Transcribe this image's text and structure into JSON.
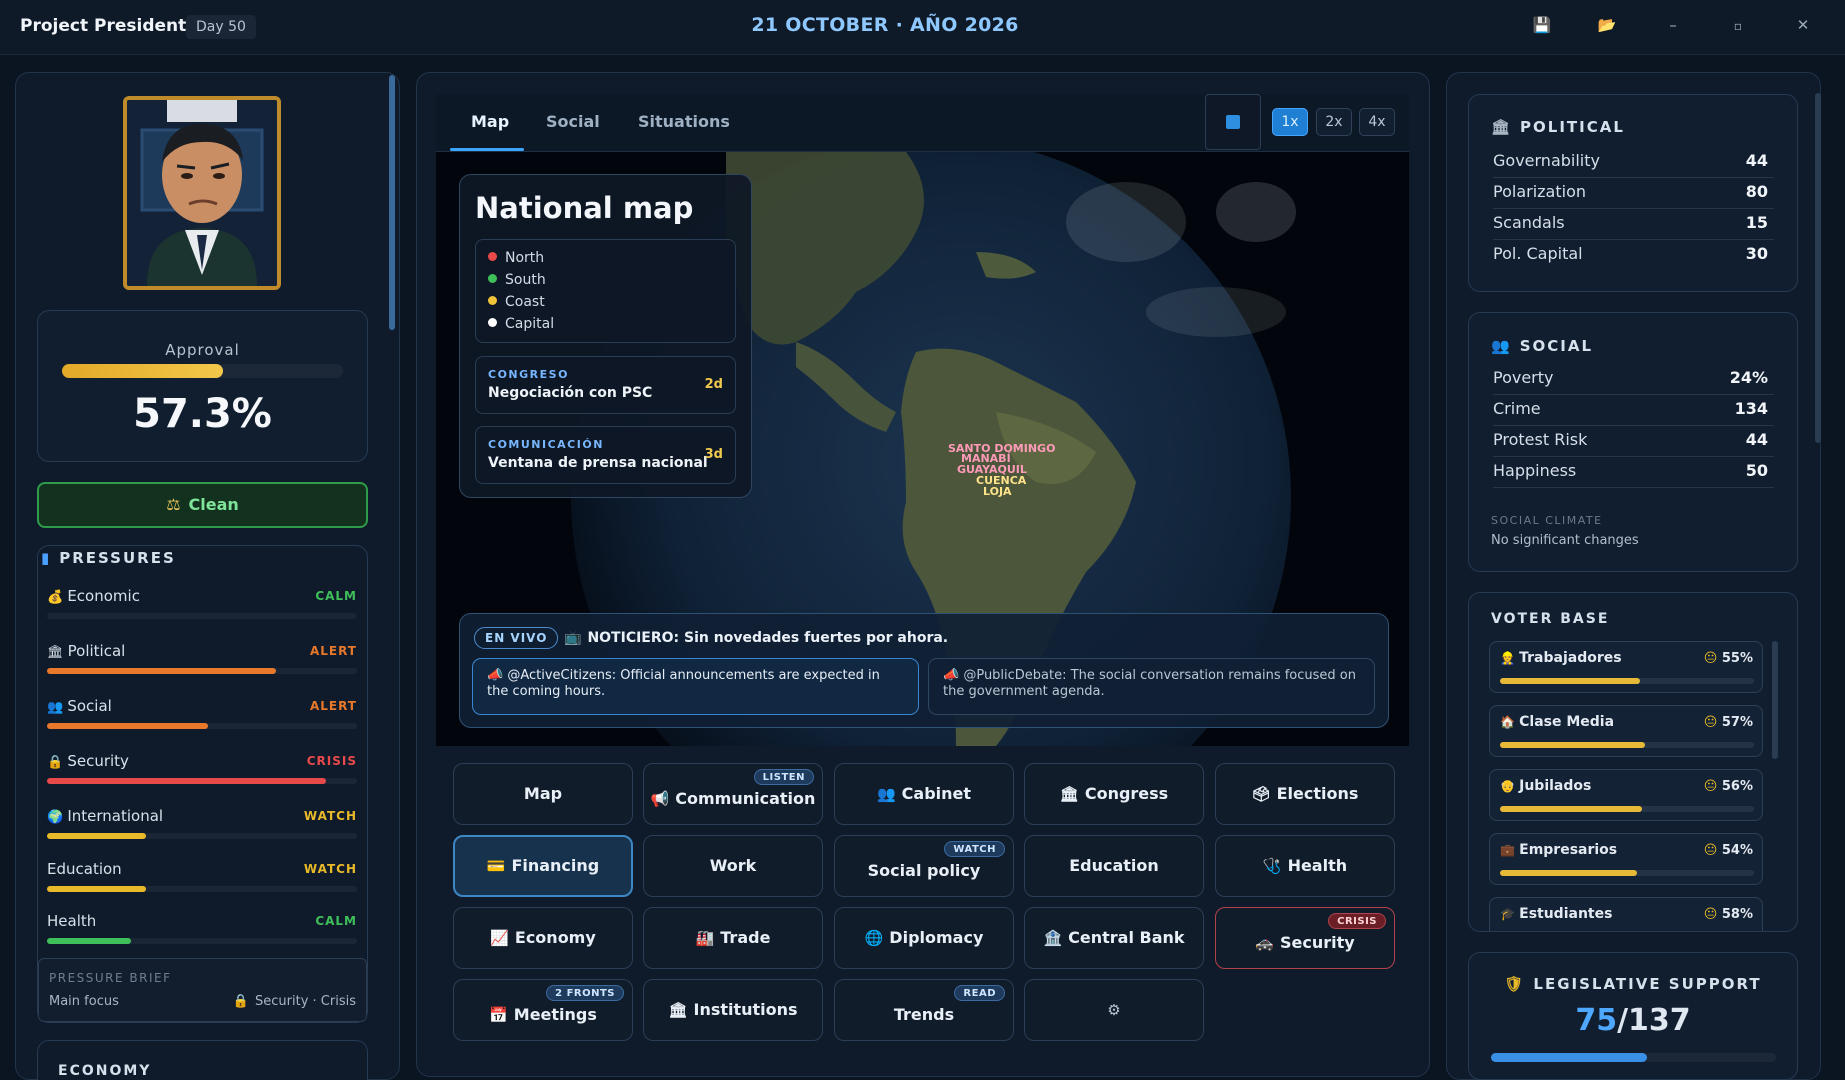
{
  "titlebar": {
    "app_title": "Project President",
    "day": "Day 50",
    "date": "21 OCTOBER · AÑO 2026",
    "icons": [
      "save-icon",
      "folder-icon",
      "minimize-icon",
      "maximize-icon",
      "close-icon"
    ]
  },
  "left": {
    "approval_label": "Approval",
    "approval_value": "57.3%",
    "approval_level": 0.573,
    "integrity_label": "Clean",
    "pressures_title": "PRESSURES",
    "pressures": [
      {
        "label": "Economic",
        "status": "CALM",
        "level": 0.0,
        "color": "#3fbf5a"
      },
      {
        "label": "Political",
        "status": "ALERT",
        "level": 0.74,
        "color": "#e8782a"
      },
      {
        "label": "Social",
        "status": "ALERT",
        "level": 0.52,
        "color": "#e8782a"
      },
      {
        "label": "Security",
        "status": "CRISIS",
        "level": 0.9,
        "color": "#e84a4a"
      },
      {
        "label": "International",
        "status": "WATCH",
        "level": 0.32,
        "color": "#e8b928"
      },
      {
        "label": "Education",
        "status": "WATCH",
        "level": 0.32,
        "color": "#e8b928"
      },
      {
        "label": "Health",
        "status": "CALM",
        "level": 0.27,
        "color": "#3fbf5a"
      }
    ],
    "brief_title": "PRESSURE BRIEF",
    "brief_focus_label": "Main focus",
    "brief_focus_value": "Security · Crisis",
    "economy_title": "ECONOMY"
  },
  "center": {
    "tabs": [
      "Map",
      "Social",
      "Situations"
    ],
    "speeds": [
      "1x",
      "2x",
      "4x"
    ],
    "active_speed": "1x",
    "map_panel": {
      "title": "National map",
      "legend": [
        {
          "label": "North",
          "color": "#e84a4a"
        },
        {
          "label": "South",
          "color": "#3fbf5a"
        },
        {
          "label": "Coast",
          "color": "#f0c23a"
        },
        {
          "label": "Capital",
          "color": "#ffffff"
        }
      ],
      "events": [
        {
          "tag": "CONGRESO",
          "text": "Negociación con PSC",
          "days": "2d"
        },
        {
          "tag": "COMUNICACIÓN",
          "text": "Ventana de prensa nacional",
          "days": "3d"
        }
      ]
    },
    "cities": [
      "SANTO DOMINGO",
      "MANABÍ",
      "GUAYAQUIL",
      "CUENCA",
      "LOJA"
    ],
    "news": {
      "live_label": "EN VIVO",
      "headline": "NOTICIERO: Sin novedades fuertes por ahora.",
      "posts": [
        "@ActiveCitizens: Official announcements are expected in the coming hours.",
        "@PublicDebate: The social conversation remains focused on the government agenda."
      ]
    },
    "actions": [
      {
        "label": "Map",
        "icon": "",
        "badge": ""
      },
      {
        "label": "Communication",
        "icon": "📢",
        "badge": "LISTEN"
      },
      {
        "label": "Cabinet",
        "icon": "👥",
        "badge": ""
      },
      {
        "label": "Congress",
        "icon": "🏛",
        "badge": ""
      },
      {
        "label": "Elections",
        "icon": "🗳",
        "badge": ""
      },
      {
        "label": "Financing",
        "icon": "💳",
        "badge": ""
      },
      {
        "label": "Work",
        "icon": "",
        "badge": ""
      },
      {
        "label": "Social policy",
        "icon": "",
        "badge": "WATCH"
      },
      {
        "label": "Education",
        "icon": "",
        "badge": ""
      },
      {
        "label": "Health",
        "icon": "🩺",
        "badge": ""
      },
      {
        "label": "Economy",
        "icon": "📈",
        "badge": ""
      },
      {
        "label": "Trade",
        "icon": "🏭",
        "badge": ""
      },
      {
        "label": "Diplomacy",
        "icon": "🌐",
        "badge": ""
      },
      {
        "label": "Central Bank",
        "icon": "🏦",
        "badge": ""
      },
      {
        "label": "Security",
        "icon": "🚓",
        "badge": "CRISIS"
      },
      {
        "label": "Meetings",
        "icon": "📅",
        "badge": "2 FRONTS"
      },
      {
        "label": "Institutions",
        "icon": "🏛",
        "badge": ""
      },
      {
        "label": "Trends",
        "icon": "",
        "badge": "READ"
      },
      {
        "label": "",
        "icon": "⚙",
        "badge": ""
      }
    ]
  },
  "right": {
    "political_title": "POLITICAL",
    "political": [
      {
        "label": "Governability",
        "value": "44"
      },
      {
        "label": "Polarization",
        "value": "80"
      },
      {
        "label": "Scandals",
        "value": "15"
      },
      {
        "label": "Pol. Capital",
        "value": "30"
      }
    ],
    "social_title": "SOCIAL",
    "social": [
      {
        "label": "Poverty",
        "value": "24%"
      },
      {
        "label": "Crime",
        "value": "134"
      },
      {
        "label": "Protest Risk",
        "value": "44"
      },
      {
        "label": "Happiness",
        "value": "50"
      }
    ],
    "social_climate_label": "SOCIAL CLIMATE",
    "social_climate_value": "No significant changes",
    "voter_title": "VOTER BASE",
    "voters": [
      {
        "label": "Trabajadores",
        "value": "55%",
        "level": 0.55
      },
      {
        "label": "Clase Media",
        "value": "57%",
        "level": 0.57
      },
      {
        "label": "Jubilados",
        "value": "56%",
        "level": 0.56
      },
      {
        "label": "Empresarios",
        "value": "54%",
        "level": 0.54
      },
      {
        "label": "Estudiantes",
        "value": "58%",
        "level": 0.58
      }
    ],
    "legislative_title": "LEGISLATIVE SUPPORT",
    "legislative_value": "75",
    "legislative_total": "/137",
    "legislative_level": 0.547
  }
}
